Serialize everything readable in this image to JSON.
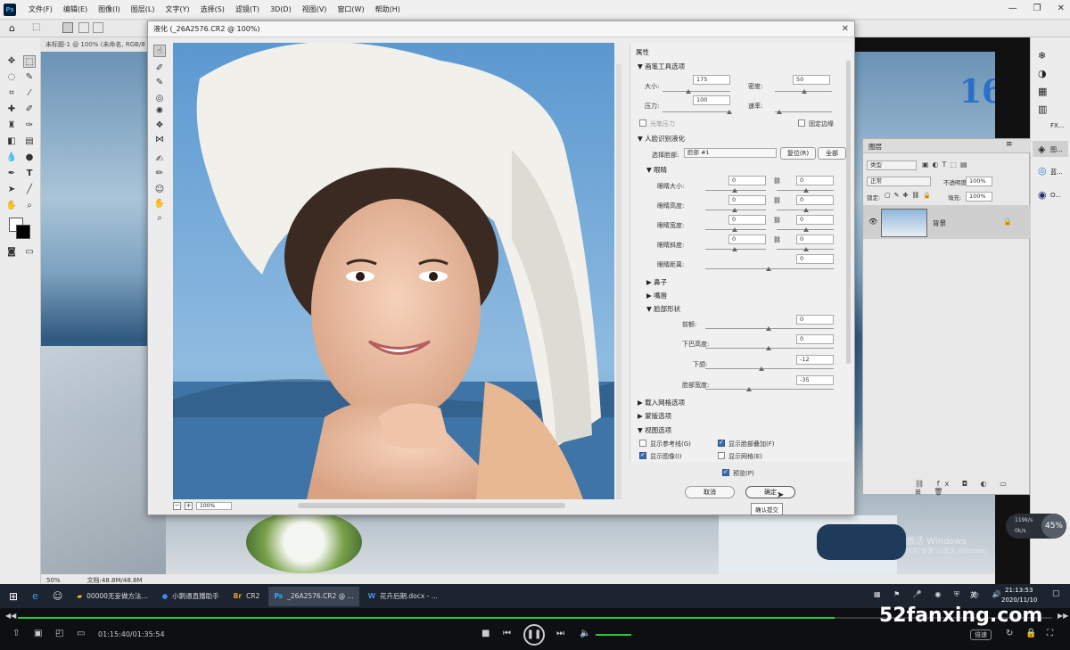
{
  "menubar": {
    "items": [
      "文件(F)",
      "编辑(E)",
      "图像(I)",
      "图层(L)",
      "文字(Y)",
      "选择(S)",
      "滤镜(T)",
      "3D(D)",
      "视图(V)",
      "窗口(W)",
      "帮助(H)"
    ]
  },
  "doc_tab": "未标题-1 @ 100% (未命名, RGB/8",
  "status": {
    "zoom": "50%",
    "doc": "文档:48.8M/48.8M"
  },
  "liquify": {
    "title": "液化 (_26A2576.CR2 @ 100%)",
    "zoom_value": "100%",
    "props_title": "属性",
    "brush_section": "画笔工具选项",
    "size_label": "大小:",
    "size_value": "175",
    "density_label": "密度:",
    "density_value": "50",
    "pressure_label": "压力:",
    "pressure_value": "100",
    "rate_label": "速率:",
    "stylus_label": "光笔压力",
    "pin_edges_label": "固定边缘",
    "face_section": "人脸识别液化",
    "select_face_label": "选择脸部:",
    "select_face_value": "脸部 #1",
    "reset_btn": "复位(R)",
    "all_btn": "全部",
    "eyes_section": "眼睛",
    "eye_rows": [
      {
        "label": "眼睛大小:",
        "left": "0",
        "right": "0"
      },
      {
        "label": "眼睛高度:",
        "left": "0",
        "right": "0"
      },
      {
        "label": "眼睛宽度:",
        "left": "0",
        "right": "0"
      },
      {
        "label": "眼睛斜度:",
        "left": "0",
        "right": "0"
      },
      {
        "label": "眼睛距离:",
        "right": "0"
      }
    ],
    "nose_section": "鼻子",
    "mouth_section": "嘴唇",
    "face_shape_section": "脸部形状",
    "shape_rows": [
      {
        "label": "前额:",
        "value": "0"
      },
      {
        "label": "下巴高度:",
        "value": "0"
      },
      {
        "label": "下颌:",
        "value": "-12"
      },
      {
        "label": "脸部宽度:",
        "value": "-35"
      }
    ],
    "load_mesh_section": "载入网格选项",
    "mask_section": "蒙版选项",
    "view_section": "视图选项",
    "show_guides": "显示参考线(G)",
    "show_face_overlay": "显示脸部叠加(F)",
    "show_image": "显示图像(I)",
    "show_mesh": "显示网格(E)",
    "preview_label": "预览(P)",
    "cancel_btn": "取消",
    "ok_btn": "确定",
    "tooltip": "确认提交"
  },
  "layers": {
    "tab": "图层",
    "kind": "类型",
    "blend": "正常",
    "opacity_label": "不透明度:",
    "opacity": "100%",
    "lock_label": "锁定:",
    "fill_label": "填充:",
    "fill": "100%",
    "layer_name": "背景"
  },
  "right_panel": {
    "fx_label": "FX...",
    "photo_label": "图...",
    "color_label": "蓝...",
    "other_label": "O..."
  },
  "watermark": {
    "line1": "激活 Windows",
    "line2": "转到\"设置\"以激活 Windows。"
  },
  "perf": {
    "up": "119k/s",
    "down": "0k/s",
    "cpu": "45%"
  },
  "taskbar": {
    "items": [
      {
        "icon": "folder-icon",
        "label": "00000无妄做方法..."
      },
      {
        "icon": "app-icon",
        "label": "小鹅通直播助手"
      },
      {
        "icon": "br-icon",
        "label": "CR2"
      },
      {
        "icon": "ps-icon",
        "label": "_26A2576.CR2 @ ..."
      },
      {
        "icon": "word-icon",
        "label": "花卉后期.docx - ..."
      }
    ],
    "ime": "英",
    "time": "21:13:53",
    "date": "2020/11/10"
  },
  "player": {
    "time": "01:15:40/01:35:54",
    "progress": 0.79,
    "speed_btn": "倍速",
    "brand": "52fanxing.com"
  },
  "colors": {
    "accent": "#2ac63d",
    "ps_blue": "#31a8ff"
  }
}
